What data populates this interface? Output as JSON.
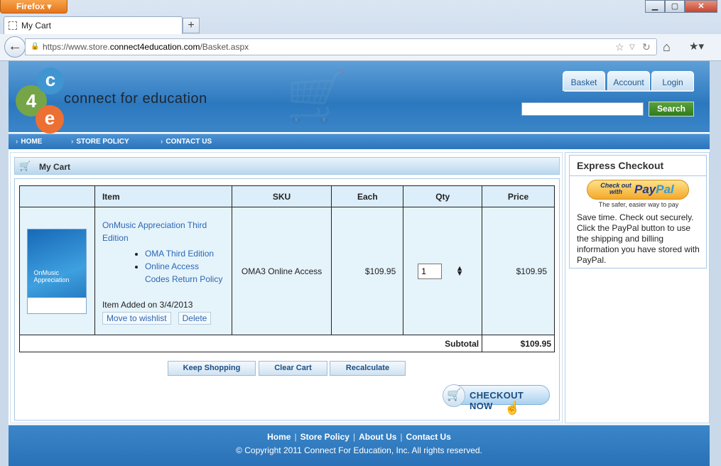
{
  "browser": {
    "app_button": "Firefox",
    "tab_title": "My Cart",
    "url_prefix": "https://www.store.",
    "url_domain": "connect4education.com",
    "url_path": "/Basket.aspx"
  },
  "header": {
    "logo_4": "4",
    "logo_c": "c",
    "logo_e": "e",
    "brand": "connect for education",
    "tabs": [
      "Basket",
      "Account",
      "Login"
    ],
    "search_button": "Search",
    "search_placeholder": ""
  },
  "menu": [
    "HOME",
    "STORE POLICY",
    "CONTACT US"
  ],
  "cart": {
    "title": "My Cart",
    "columns": [
      "Item",
      "SKU",
      "Each",
      "Qty",
      "Price"
    ],
    "item": {
      "title": "OnMusic Appreciation Third Edition",
      "sub_links": [
        "OMA Third Edition",
        "Online Access Codes Return Policy"
      ],
      "added": "Item Added on 3/4/2013",
      "wishlist_button": "Move to wishlist",
      "delete_button": "Delete",
      "book_cover_text": "OnMusic Appreciation",
      "sku": "OMA3 Online Access",
      "each": "$109.95",
      "qty": "1",
      "price": "$109.95"
    },
    "subtotal_label": "Subtotal",
    "subtotal_value": "$109.95",
    "buttons": [
      "Keep Shopping",
      "Clear Cart",
      "Recalculate"
    ],
    "checkout": "CHECKOUT NOW"
  },
  "express": {
    "title": "Express Checkout",
    "paypal_check_out": "Check out with",
    "paypal_logo_pay": "Pay",
    "paypal_logo_pal": "Pal",
    "tagline": "The safer, easier way to pay",
    "text": "Save time. Check out securely. Click the PayPal button to use the shipping and billing information you have stored with PayPal."
  },
  "footer": {
    "links": [
      "Home",
      "Store Policy",
      "About Us",
      "Contact Us"
    ],
    "copyright": "© Copyright 2011 Connect For Education, Inc. All rights reserved."
  }
}
